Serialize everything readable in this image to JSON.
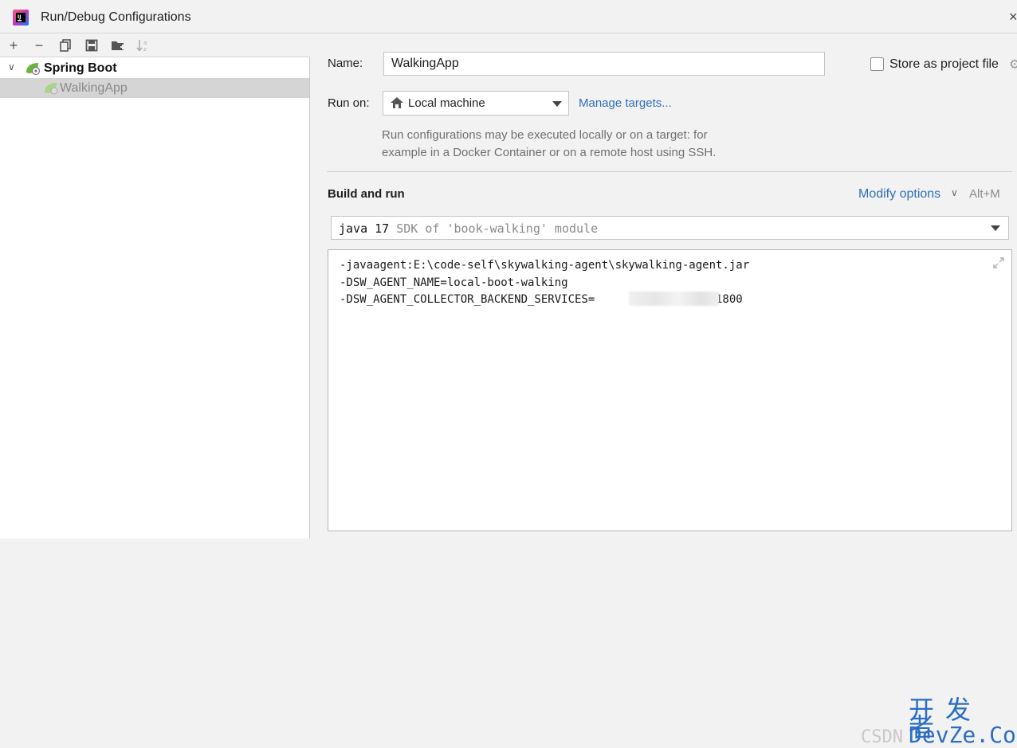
{
  "window": {
    "title": "Run/Debug Configurations",
    "close_glyph": "×"
  },
  "toolbar": {
    "add_glyph": "+",
    "remove_glyph": "−"
  },
  "tree": {
    "group_label": "Spring Boot",
    "item_label": "WalkingApp",
    "expand_glyph": "∨"
  },
  "form": {
    "name_label": "Name:",
    "name_value": "WalkingApp",
    "store_label": "Store as project file",
    "store_checked": false,
    "runon_label": "Run on:",
    "runon_value": "Local machine",
    "manage_targets": "Manage targets...",
    "hint_line1": "Run configurations may be executed locally or on a target: for",
    "hint_line2": "example in a Docker Container or on a remote host using SSH."
  },
  "build_and_run": {
    "title": "Build and run",
    "modify_options": "Modify options",
    "modify_chevron": "∨",
    "shortcut": "Alt+M",
    "sdk_main": "java 17",
    "sdk_detail": "SDK of 'book-walking' module",
    "vm_options": [
      "-javaagent:E:\\code-self\\skywalking-agent\\skywalking-agent.jar",
      "-DSW_AGENT_NAME=local-boot-walking",
      "-DSW_AGENT_COLLECTOR_BACKEND_SERVICES=                :11800"
    ]
  },
  "watermark": {
    "csdn": "CSDN",
    "cn": "开发者",
    "en": "DevZe.CoM"
  },
  "colors": {
    "accent_link": "#2f6fb7",
    "selection": "#d5d5d5",
    "spring_green": "#6db33f"
  },
  "icons": {
    "app": "intellij-app-icon",
    "copy": "copy-icon",
    "save": "save-icon",
    "folder": "new-folder-icon",
    "sort": "sort-az-icon",
    "spring": "spring-boot-icon",
    "home": "home-icon",
    "expand": "expand-editor-icon",
    "gear": "gear-icon"
  }
}
